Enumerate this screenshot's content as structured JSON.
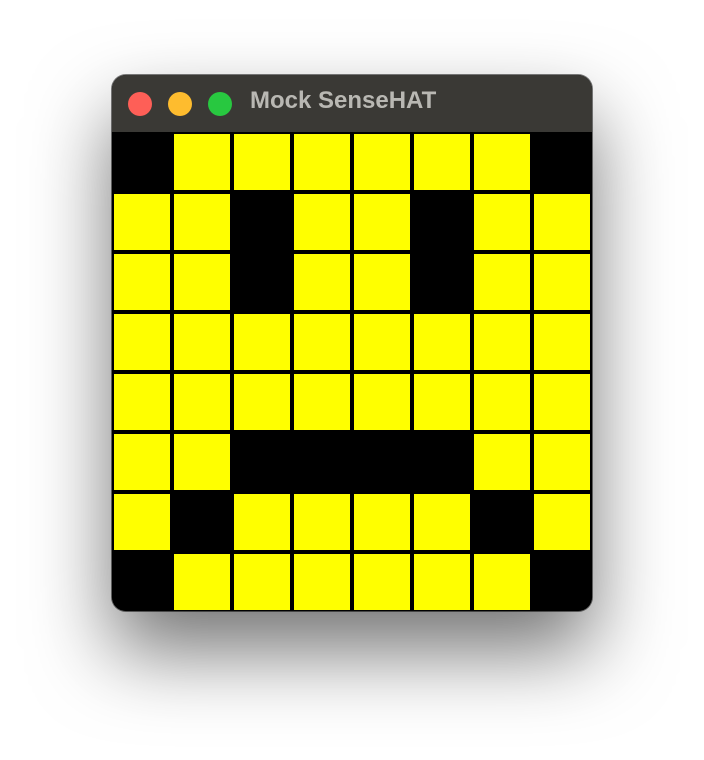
{
  "window": {
    "title": "Mock SenseHAT",
    "controls": {
      "close_color": "#fe5f57",
      "minimize_color": "#febc2e",
      "zoom_color": "#28c840"
    }
  },
  "led_matrix": {
    "colors": {
      "Y": "#ffff00",
      "K": "#000000"
    },
    "rows": [
      [
        "K",
        "Y",
        "Y",
        "Y",
        "Y",
        "Y",
        "Y",
        "K"
      ],
      [
        "Y",
        "Y",
        "K",
        "Y",
        "Y",
        "K",
        "Y",
        "Y"
      ],
      [
        "Y",
        "Y",
        "K",
        "Y",
        "Y",
        "K",
        "Y",
        "Y"
      ],
      [
        "Y",
        "Y",
        "Y",
        "Y",
        "Y",
        "Y",
        "Y",
        "Y"
      ],
      [
        "Y",
        "Y",
        "Y",
        "Y",
        "Y",
        "Y",
        "Y",
        "Y"
      ],
      [
        "Y",
        "Y",
        "K",
        "K",
        "K",
        "K",
        "Y",
        "Y"
      ],
      [
        "Y",
        "K",
        "Y",
        "Y",
        "Y",
        "Y",
        "K",
        "Y"
      ],
      [
        "K",
        "Y",
        "Y",
        "Y",
        "Y",
        "Y",
        "Y",
        "K"
      ]
    ]
  }
}
